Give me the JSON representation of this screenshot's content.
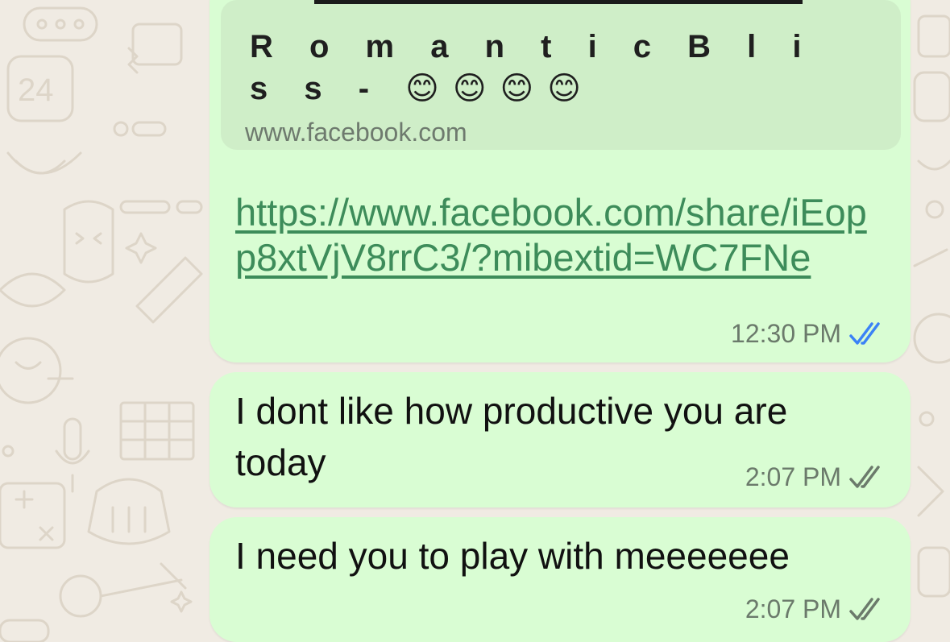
{
  "link_message": {
    "preview_title": "R o m a n t i c  B l i s s - 😊😊😊😊",
    "preview_domain": "www.facebook.com",
    "link": "https://www.facebook.com/share/iEopp8xtVjV8rrC3/?mibextid=WC7FNe",
    "time": "12:30 PM",
    "status": "read"
  },
  "messages": [
    {
      "text": "I dont like how productive you are today",
      "time": "2:07 PM",
      "status": "delivered"
    },
    {
      "text": "I need you to play with meeeeeee",
      "time": "2:07 PM",
      "status": "delivered"
    }
  ],
  "colors": {
    "bubble_outgoing": "#d9fdd3",
    "read_tick": "#3b82f6",
    "delivered_tick": "#6b7a6b",
    "link": "#3d8c5a",
    "wallpaper": "#f0ebe3"
  }
}
